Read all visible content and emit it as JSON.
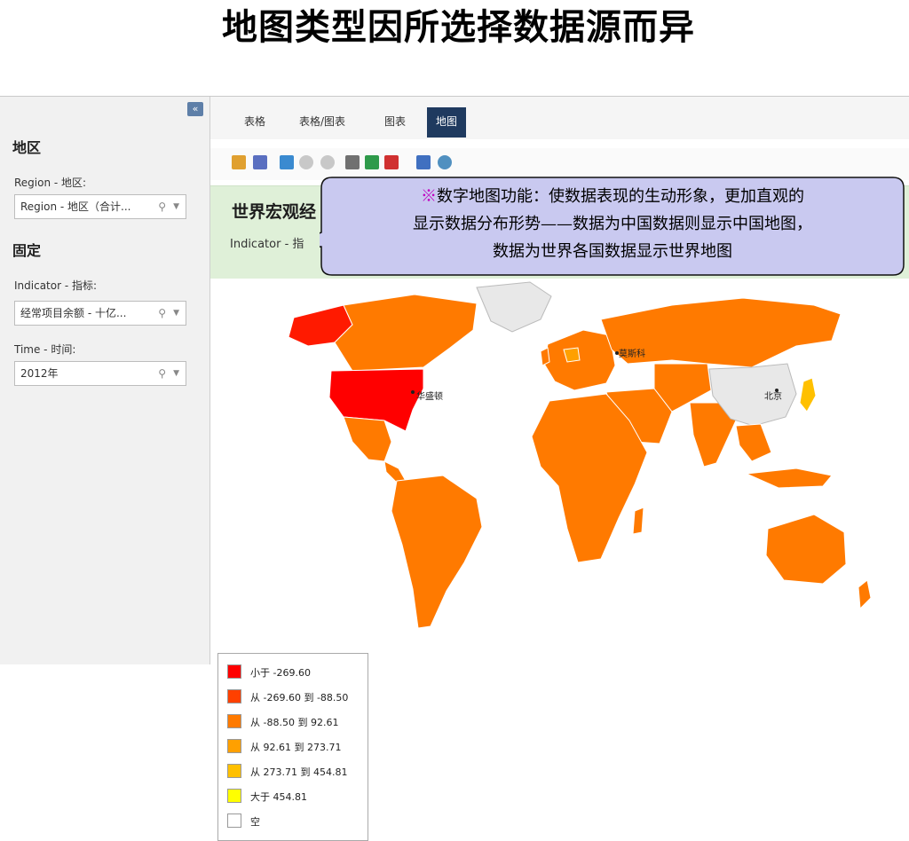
{
  "slide": {
    "title": "地图类型因所选择数据源而异"
  },
  "left_panel": {
    "collapse_label": "«",
    "region_section": "地区",
    "region_label": "Region - 地区:",
    "region_value": "Region - 地区（合计...",
    "fixed_section": "固定",
    "indicator_label": "Indicator - 指标:",
    "indicator_value": "经常项目余额 - 十亿...",
    "time_label": "Time - 时间:",
    "time_value": "2012年"
  },
  "tabs": [
    {
      "label": "表格"
    },
    {
      "label": "表格/图表"
    },
    {
      "label": "图表"
    },
    {
      "label": "地图"
    }
  ],
  "report": {
    "title": "世界宏观经",
    "indicator": "Indicator - 指"
  },
  "callout": {
    "mark": "※",
    "line1": "数字地图功能：使数据表现的生动形象，更加直观的",
    "line2": "显示数据分布形势——数据为中国数据则显示中国地图，",
    "line3": "数据为世界各国数据显示世界地图"
  },
  "map": {
    "cities": {
      "moscow": "莫斯科",
      "washington": "华盛顿",
      "beijing": "北京"
    }
  },
  "legend": [
    {
      "label": "小于 -269.60",
      "color": "#ff0000"
    },
    {
      "label": "从 -269.60 到 -88.50",
      "color": "#ff4000"
    },
    {
      "label": "从 -88.50 到 92.61",
      "color": "#ff7a00"
    },
    {
      "label": "从 92.61 到 273.71",
      "color": "#ffa000"
    },
    {
      "label": "从 273.71 到 454.81",
      "color": "#ffc000"
    },
    {
      "label": "大于 454.81",
      "color": "#ffff00"
    },
    {
      "label": "空",
      "color": "#ffffff"
    }
  ],
  "icons": [
    "export-icon",
    "save-icon",
    "refresh-icon",
    "undo-icon",
    "redo-icon",
    "print-icon",
    "excel-icon",
    "pdf-icon",
    "chart-icon",
    "globe-icon",
    "search-icon",
    "chevron-down-icon"
  ]
}
